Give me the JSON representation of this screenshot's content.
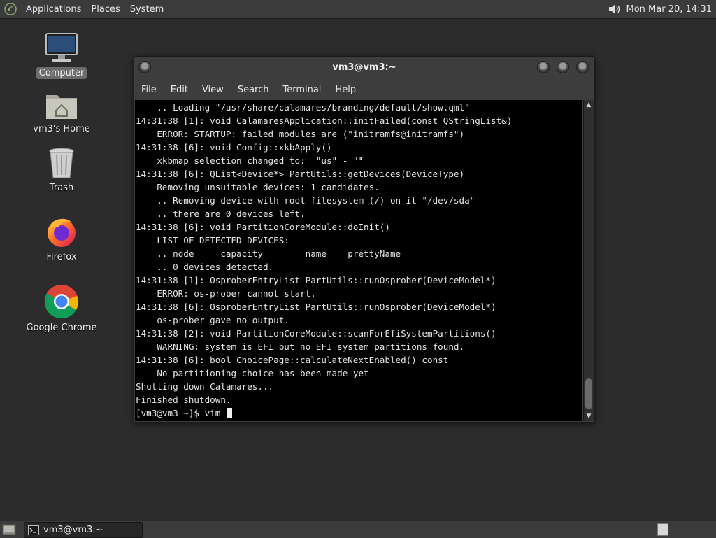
{
  "top_panel": {
    "menus": [
      "Applications",
      "Places",
      "System"
    ],
    "clock": "Mon Mar 20, 14:31",
    "icons": {
      "logo": "mate-logo-icon",
      "volume": "volume-icon"
    }
  },
  "desktop": {
    "icons": [
      {
        "label": "Computer",
        "icon": "computer-icon",
        "selected": true
      },
      {
        "label": "vm3's Home",
        "icon": "home-folder-icon"
      },
      {
        "label": "Trash",
        "icon": "trash-icon"
      },
      {
        "label": "Firefox",
        "icon": "firefox-icon"
      },
      {
        "label": "Google Chrome",
        "icon": "chrome-icon"
      }
    ]
  },
  "terminal_window": {
    "title": "vm3@vm3:~",
    "menus": [
      "File",
      "Edit",
      "View",
      "Search",
      "Terminal",
      "Help"
    ],
    "lines": [
      "    .. Loading \"/usr/share/calamares/branding/default/show.qml\"",
      "14:31:38 [1]: void CalamaresApplication::initFailed(const QStringList&)",
      "    ERROR: STARTUP: failed modules are (\"initramfs@initramfs\")",
      "14:31:38 [6]: void Config::xkbApply()",
      "    xkbmap selection changed to:  \"us\" - \"\"",
      "14:31:38 [6]: QList<Device*> PartUtils::getDevices(DeviceType)",
      "    Removing unsuitable devices: 1 candidates.",
      "    .. Removing device with root filesystem (/) on it \"/dev/sda\"",
      "    .. there are 0 devices left.",
      "14:31:38 [6]: void PartitionCoreModule::doInit()",
      "    LIST OF DETECTED DEVICES:",
      "    .. node     capacity        name    prettyName",
      "    .. 0 devices detected.",
      "14:31:38 [1]: OsproberEntryList PartUtils::runOsprober(DeviceModel*)",
      "    ERROR: os-prober cannot start.",
      "14:31:38 [6]: OsproberEntryList PartUtils::runOsprober(DeviceModel*)",
      "    os-prober gave no output.",
      "14:31:38 [2]: void PartitionCoreModule::scanForEfiSystemPartitions()",
      "    WARNING: system is EFI but no EFI system partitions found.",
      "14:31:38 [6]: bool ChoicePage::calculateNextEnabled() const",
      "    No partitioning choice has been made yet",
      "Shutting down Calamares...",
      "Finished shutdown."
    ],
    "prompt": "[vm3@vm3 ~]$ vim "
  },
  "bottom_panel": {
    "task_label": "vm3@vm3:~",
    "icons": {
      "show_desktop": "show-desktop-icon",
      "task": "terminal-icon",
      "workspace": "workspace-switcher-icon"
    }
  }
}
